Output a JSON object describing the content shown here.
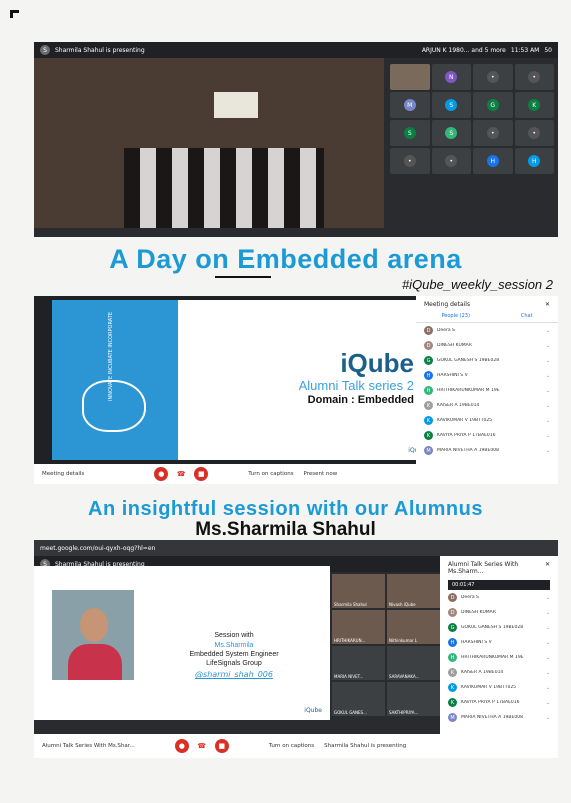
{
  "panel1": {
    "presenting": "Sharmila Shahul is presenting",
    "top_right": "ARJUN K 1980... and 5 more",
    "time": "11:53 AM",
    "count": "50"
  },
  "heading1": "A Day on Embedded arena",
  "hashtag": "#iQube_weekly_session 2",
  "panel2": {
    "slide_vertical": "INNOVATE INCUBATE INCORPORATE",
    "brand": "iQube",
    "series": "Alumni Talk series 2",
    "domain": "Domain : Embedded",
    "small_logo": "iQube",
    "side_title": "Meeting details",
    "tab_people": "People (23)",
    "tab_chat": "Chat",
    "people": [
      {
        "initial": "D",
        "name": "Deera S",
        "color": "#8d6e63"
      },
      {
        "initial": "D",
        "name": "DINESH KUMAR",
        "color": "#a1887f"
      },
      {
        "initial": "G",
        "name": "GOKUL GANESH S 19BE028",
        "color": "#0b8043"
      },
      {
        "initial": "H",
        "name": "HARSHINI S V",
        "color": "#1a73e8"
      },
      {
        "initial": "H",
        "name": "HRITHIKARUNKUMAR M 19E",
        "color": "#33b679"
      },
      {
        "initial": "K",
        "name": "KAISER A 19BE014",
        "color": "#9e9e9e"
      },
      {
        "initial": "K",
        "name": "KAVIKUMAR V 19BTT025",
        "color": "#039be5"
      },
      {
        "initial": "K",
        "name": "KAVIYA PRIYA P 17BAE016",
        "color": "#0b8043"
      },
      {
        "initial": "M",
        "name": "MARIA NIVETHA A 19BE008",
        "color": "#7986cb"
      }
    ],
    "bottom_label": "Meeting details",
    "captions": "Turn on captions",
    "present": "Present now"
  },
  "heading2": "An insightful session with our Alumnus",
  "heading3": "Ms.Sharmila Shahul",
  "panel3": {
    "url": "meet.google.com/oui-qyxh-oqg?hl=en",
    "presenting": "Sharmila Shahul is presenting",
    "session_with": "Session with",
    "name": "Ms.Sharmila",
    "role": "Embedded System Engineer",
    "company": "LifeSignals Group",
    "handle": "@sharmi_shah_006",
    "logo": "iQube",
    "side_title": "Alumni Talk Series With Ms.Sharm...",
    "time": "00:01:47",
    "video_labels": [
      "Sharmila Shahul",
      "Nivash iQube",
      "HRITHIKARUN...",
      "Nithinkumar L",
      "MARIA NIVET...",
      "SARAVANAKA...",
      "GOKUL GANES...",
      "SAKTHIPRIYA..."
    ],
    "bottom_label": "Alumni Talk Series With Ms.Shar...",
    "captions": "Turn on captions",
    "presenting_bottom": "Sharmila Shahul is presenting"
  }
}
